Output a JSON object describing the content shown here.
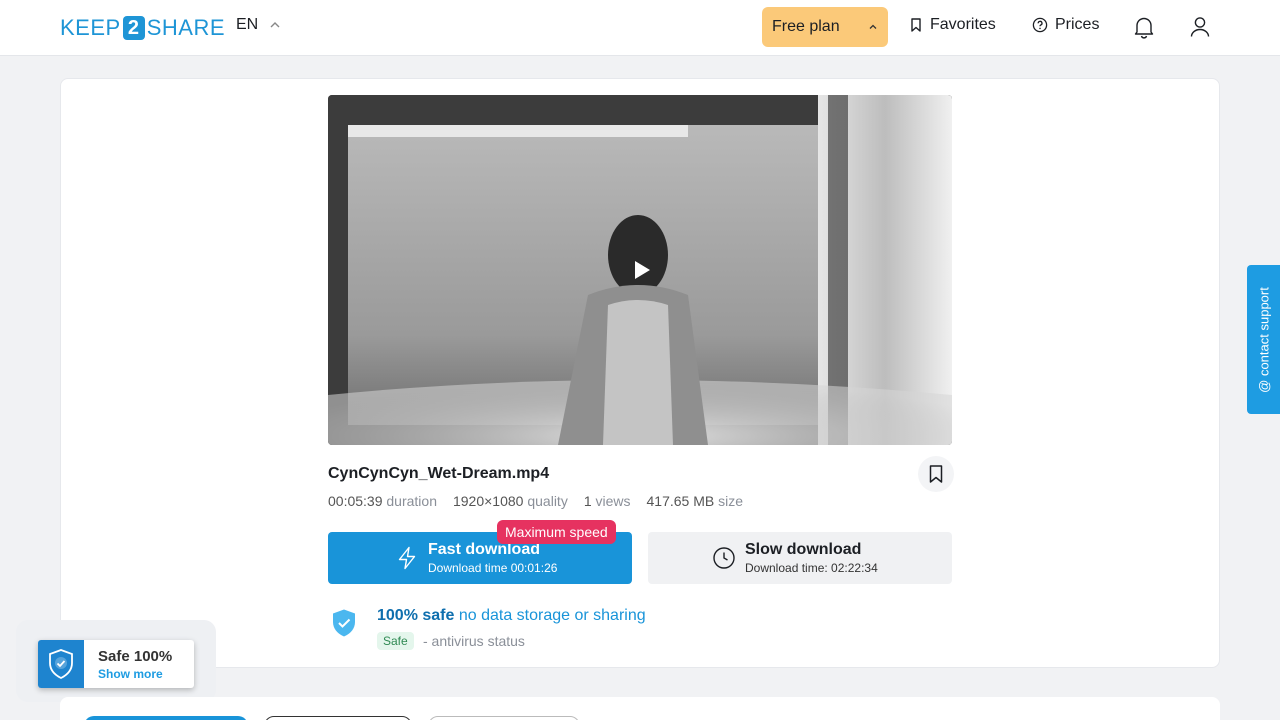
{
  "header": {
    "logo_left": "KEEP",
    "logo_mid": "2",
    "logo_right": "SHARE",
    "language": "EN",
    "plan_label": "Free plan",
    "favorites_label": "Favorites",
    "prices_label": "Prices"
  },
  "file": {
    "name": "CynCynCyn_Wet-Dream.mp4",
    "duration_value": "00:05:39",
    "duration_label": "duration",
    "quality_value": "1920×1080",
    "quality_label": "quality",
    "views_value": "1",
    "views_label": "views",
    "size_value": "417.65 MB",
    "size_label": "size"
  },
  "download": {
    "fast_label": "Fast download",
    "fast_time": "Download time 00:01:26",
    "speed_badge": "Maximum speed",
    "slow_label": "Slow download",
    "slow_time": "Download time: 02:22:34"
  },
  "safety": {
    "headline_bold": "100% safe",
    "headline_rest": "no data storage or sharing",
    "tag": "Safe",
    "note": "- antivirus status"
  },
  "contact_tab": "@ contact support",
  "popup": {
    "title": "Safe 100%",
    "link": "Show more"
  },
  "colors": {
    "accent": "#1994d9",
    "plan": "#fbc979",
    "badge": "#e63260"
  }
}
